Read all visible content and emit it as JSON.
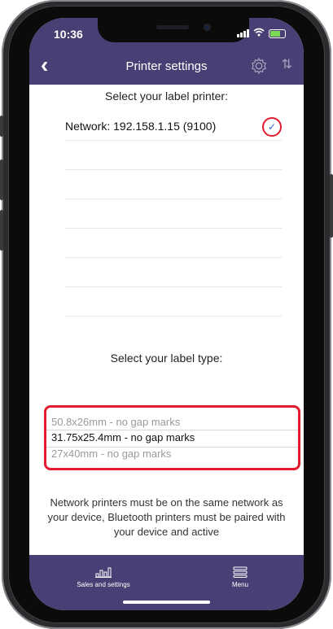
{
  "status": {
    "time": "10:36"
  },
  "nav": {
    "title": "Printer settings"
  },
  "printer_section": {
    "title": "Select your label printer:",
    "printers": [
      {
        "label": "Network: 192.158.1.15 (9100)",
        "selected": true
      },
      {
        "label": ""
      },
      {
        "label": ""
      },
      {
        "label": ""
      },
      {
        "label": ""
      },
      {
        "label": ""
      },
      {
        "label": ""
      }
    ]
  },
  "label_section": {
    "title": "Select your label type:",
    "options": [
      "50.8x26mm - no gap marks",
      "31.75x25.4mm - no gap marks",
      "27x40mm - no gap marks"
    ],
    "selected": "31.75x25.4mm - no gap marks"
  },
  "footer_note": "Network printers must be on the same network as your device, Bluetooth printers must be paired with your device and active",
  "tabbar": {
    "left_label": "Sales and settings",
    "right_label": "Menu"
  },
  "colors": {
    "accent": "#4a3f74",
    "highlight": "#e21b2e",
    "check": "#2a64c9"
  }
}
